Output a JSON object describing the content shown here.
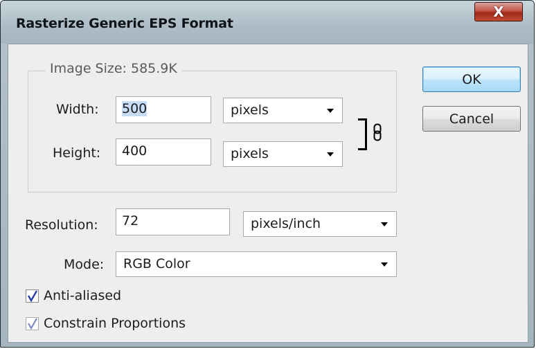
{
  "window": {
    "title": "Rasterize Generic EPS Format",
    "close_glyph": "X"
  },
  "image_size": {
    "label": "Image Size: 585.9K",
    "width_label": "Width:",
    "width_value": "500",
    "width_unit": "pixels",
    "height_label": "Height:",
    "height_value": "400",
    "height_unit": "pixels",
    "link_icon": "chain-link-icon"
  },
  "resolution": {
    "label": "Resolution:",
    "value": "72",
    "unit": "pixels/inch"
  },
  "mode": {
    "label": "Mode:",
    "value": "RGB Color"
  },
  "options": {
    "anti_aliased_label": "Anti-aliased",
    "anti_aliased_checked": true,
    "constrain_label": "Constrain Proportions",
    "constrain_checked": true
  },
  "buttons": {
    "ok": "OK",
    "cancel": "Cancel"
  },
  "colors": {
    "titlebar": "#aebdc6",
    "close_button": "#c25546",
    "default_button": "#bee6fd",
    "dialog_background": "#eeeeee"
  }
}
